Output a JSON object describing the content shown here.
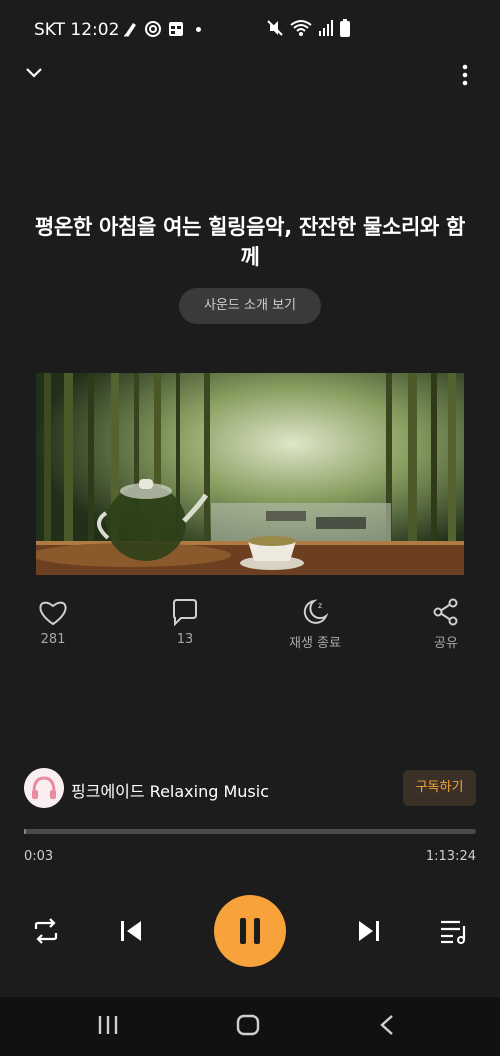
{
  "status_bar": {
    "carrier_time": "SKT 12:02",
    "left_icons": [
      "pen-icon",
      "settings-gear-icon",
      "image-icon",
      "dot-icon"
    ],
    "right_icons": [
      "mute-icon",
      "wifi-icon",
      "signal-icon",
      "battery-icon"
    ]
  },
  "header": {
    "collapse_icon": "chevron-down-icon",
    "menu_icon": "more-vert-icon"
  },
  "track": {
    "title": "평온한 아침을 여는 힐링음악, 잔잔한 물소리와 함께",
    "intro_button": "사운드 소개 보기"
  },
  "actions": [
    {
      "name": "like",
      "icon": "heart-icon",
      "label": "281"
    },
    {
      "name": "comment",
      "icon": "comment-icon",
      "label": "13"
    },
    {
      "name": "sleep-timer",
      "icon": "moon-sleep-icon",
      "label": "재생 종료"
    },
    {
      "name": "share",
      "icon": "share-icon",
      "label": "공유"
    }
  ],
  "channel": {
    "name": "핑크에이드 Relaxing Music",
    "subscribe_label": "구독하기"
  },
  "progress": {
    "current": "0:03",
    "total": "1:13:24",
    "fraction": 0.001
  },
  "controls": {
    "repeat": "repeat-icon",
    "previous": "skip-previous-icon",
    "play_pause": "pause-icon",
    "next": "skip-next-icon",
    "playlist": "playlist-icon"
  },
  "colors": {
    "background": "#1c1c1c",
    "accent": "#f7a23a",
    "subscribe_text": "#f3a23e"
  }
}
